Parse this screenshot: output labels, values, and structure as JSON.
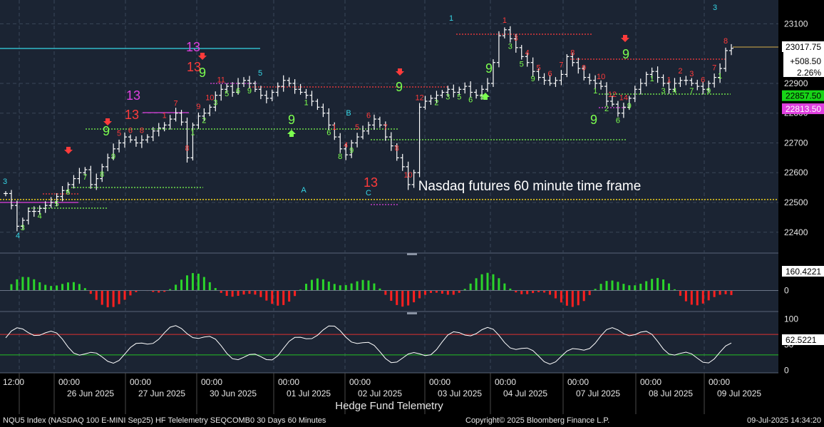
{
  "colors": {
    "bg": "#1b2433",
    "grid": "#3a4658",
    "bar": "#ffffff",
    "buy": "#7cff4f",
    "sell": "#ff3b3b",
    "cyan": "#35d6e6",
    "magenta": "#e040e0",
    "yellow": "#f2d21b"
  },
  "chart_data": [
    {
      "type": "ohlc",
      "title": "Nasdaq futures 60 minute time frame",
      "y_axis": {
        "ticks": [
          22400,
          22500,
          22600,
          22700,
          22800,
          22900,
          23100
        ],
        "ylim": [
          22330,
          23180
        ]
      },
      "x_axis": {
        "ticks": [
          {
            "time": "12:00",
            "date": ""
          },
          {
            "time": "00:00",
            "date": "26 Jun 2025"
          },
          {
            "time": "00:00",
            "date": "27 Jun 2025"
          },
          {
            "time": "00:00",
            "date": "30 Jun 2025"
          },
          {
            "time": "00:00",
            "date": "01 Jul 2025"
          },
          {
            "time": "00:00",
            "date": "02 Jul 2025"
          },
          {
            "time": "00:00",
            "date": "03 Jul 2025"
          },
          {
            "time": "00:00",
            "date": "04 Jul 2025"
          },
          {
            "time": "00:00",
            "date": "07 Jul 2025"
          },
          {
            "time": "00:00",
            "date": "08 Jul 2025"
          },
          {
            "time": "00:00",
            "date": "09 Jul 2025"
          }
        ]
      },
      "series": [
        {
          "values": [
            22530,
            22490,
            22420,
            22440,
            22470,
            22470,
            22480,
            22490,
            22500,
            22520,
            22540,
            22560,
            22580,
            22600,
            22610,
            22560,
            22580,
            22620,
            22650,
            22680,
            22700,
            22720,
            22710,
            22700,
            22710,
            22720,
            22740,
            22750,
            22760,
            22780,
            22800,
            22770,
            22650,
            22760,
            22790,
            22800,
            22820,
            22860,
            22880,
            22890,
            22870,
            22900,
            22910,
            22900,
            22880,
            22860,
            22850,
            22870,
            22890,
            22910,
            22900,
            22880,
            22870,
            22860,
            22840,
            22820,
            22800,
            22760,
            22720,
            22680,
            22660,
            22700,
            22720,
            22740,
            22760,
            22780,
            22760,
            22720,
            22690,
            22650,
            22620,
            22560,
            22600,
            22820,
            22840,
            22850,
            22860,
            22870,
            22880,
            22870,
            22880,
            22890,
            22870,
            22860,
            22880,
            22900,
            22970,
            23060,
            23080,
            23050,
            23020,
            22990,
            22970,
            22940,
            22920,
            22910,
            22900,
            22910,
            22930,
            22990,
            22970,
            22950,
            22920,
            22910,
            22900,
            22890,
            22840,
            22830,
            22800,
            22820,
            22850,
            22880,
            22900,
            22930,
            22940,
            22920,
            22900,
            22880,
            22900,
            22910,
            22910,
            22900,
            22890,
            22880,
            22900,
            22920,
            22950,
            23010,
            23017.75
          ]
        }
      ],
      "price_labels": [
        {
          "value": 23017.75,
          "text": "23017.75",
          "bg": "#ffffff",
          "fg": "#000000"
        },
        {
          "value": 22857.5,
          "text": "22857.50",
          "bg": "#17d417",
          "fg": "#000000"
        },
        {
          "value": 22813.5,
          "text": "22813.50",
          "bg": "#e040e0",
          "fg": "#ffffff"
        }
      ],
      "change_box": [
        "+508.50",
        "2.26%"
      ],
      "annotations": {
        "buy_counts": [
          {
            "i": 3,
            "t": "3"
          },
          {
            "i": 6,
            "t": "4"
          },
          {
            "i": 9,
            "t": "5"
          },
          {
            "i": 11,
            "t": "6"
          },
          {
            "i": 14,
            "t": "7"
          },
          {
            "i": 17,
            "t": "8"
          },
          {
            "i": 19,
            "t": "9"
          },
          {
            "i": 33,
            "t": "1"
          },
          {
            "i": 35,
            "t": "2"
          },
          {
            "i": 37,
            "t": "3"
          },
          {
            "i": 39,
            "t": "5"
          },
          {
            "i": 41,
            "t": "6"
          },
          {
            "i": 43,
            "t": "9"
          },
          {
            "i": 53,
            "t": "1"
          },
          {
            "i": 57,
            "t": "6"
          },
          {
            "i": 59,
            "t": "8"
          },
          {
            "i": 61,
            "t": "9"
          },
          {
            "i": 76,
            "t": "2"
          },
          {
            "i": 78,
            "t": "3"
          },
          {
            "i": 80,
            "t": "5"
          },
          {
            "i": 82,
            "t": "6"
          },
          {
            "i": 84,
            "t": "9"
          },
          {
            "i": 89,
            "t": "3"
          },
          {
            "i": 91,
            "t": "5"
          },
          {
            "i": 93,
            "t": "9"
          },
          {
            "i": 104,
            "t": "1"
          },
          {
            "i": 106,
            "t": "2"
          },
          {
            "i": 108,
            "t": "6"
          },
          {
            "i": 110,
            "t": "9"
          },
          {
            "i": 114,
            "t": "1"
          },
          {
            "i": 116,
            "t": "3"
          },
          {
            "i": 118,
            "t": "4"
          },
          {
            "i": 121,
            "t": "7"
          },
          {
            "i": 124,
            "t": "9"
          },
          {
            "i": 126,
            "t": "1"
          }
        ],
        "sell_counts": [
          {
            "i": 20,
            "t": "5"
          },
          {
            "i": 22,
            "t": "6"
          },
          {
            "i": 24,
            "t": "8"
          },
          {
            "i": 28,
            "t": "1"
          },
          {
            "i": 30,
            "t": "7"
          },
          {
            "i": 32,
            "t": "8"
          },
          {
            "i": 34,
            "t": "9"
          },
          {
            "i": 36,
            "t": "10"
          },
          {
            "i": 38,
            "t": "11"
          },
          {
            "i": 58,
            "t": "1"
          },
          {
            "i": 60,
            "t": "4"
          },
          {
            "i": 62,
            "t": "5"
          },
          {
            "i": 64,
            "t": "6"
          },
          {
            "i": 67,
            "t": "7"
          },
          {
            "i": 69,
            "t": "8"
          },
          {
            "i": 71,
            "t": "10"
          },
          {
            "i": 73,
            "t": "12"
          },
          {
            "i": 88,
            "t": "1"
          },
          {
            "i": 90,
            "t": "3"
          },
          {
            "i": 92,
            "t": "4"
          },
          {
            "i": 94,
            "t": "5"
          },
          {
            "i": 96,
            "t": "6"
          },
          {
            "i": 98,
            "t": "7"
          },
          {
            "i": 100,
            "t": "8"
          },
          {
            "i": 102,
            "t": "9"
          },
          {
            "i": 105,
            "t": "10"
          },
          {
            "i": 107,
            "t": "12"
          },
          {
            "i": 109,
            "t": "14"
          },
          {
            "i": 117,
            "t": "1"
          },
          {
            "i": 119,
            "t": "2"
          },
          {
            "i": 121,
            "t": "3"
          },
          {
            "i": 123,
            "t": "6"
          },
          {
            "i": 125,
            "t": "7"
          },
          {
            "i": 127,
            "t": "8"
          }
        ],
        "big_labels": [
          {
            "x": 271,
            "y": 72,
            "t": "13",
            "c": "magenta"
          },
          {
            "x": 187,
            "y": 140,
            "t": "13",
            "c": "magenta"
          },
          {
            "x": 272,
            "y": 100,
            "t": "13",
            "c": "sell"
          },
          {
            "x": 185,
            "y": 167,
            "t": "13",
            "c": "sell"
          },
          {
            "x": 520,
            "y": 262,
            "t": "13",
            "c": "sell"
          },
          {
            "x": 284,
            "y": 108,
            "t": "9",
            "c": "buy"
          },
          {
            "x": 149,
            "y": 190,
            "t": "9",
            "c": "buy"
          },
          {
            "x": 409,
            "y": 174,
            "t": "9",
            "c": "buy"
          },
          {
            "x": 560,
            "y": 128,
            "t": "9",
            "c": "buy"
          },
          {
            "x": 686,
            "y": 102,
            "t": "9",
            "c": "buy"
          },
          {
            "x": 833,
            "y": 174,
            "t": "9",
            "c": "buy"
          },
          {
            "x": 878,
            "y": 82,
            "t": "9",
            "c": "buy"
          }
        ],
        "cyan_letters": [
          {
            "x": 426,
            "y": 270,
            "t": "A"
          },
          {
            "x": 489,
            "y": 162,
            "t": "B"
          },
          {
            "x": 517,
            "y": 274,
            "t": "C"
          }
        ],
        "cyan_numbers": [
          {
            "x": 7,
            "y": 258,
            "t": "3"
          },
          {
            "x": 25,
            "y": 334,
            "t": "4"
          },
          {
            "x": 633,
            "y": 29,
            "t": "1"
          },
          {
            "x": 365,
            "y": 106,
            "t": "5"
          },
          {
            "x": 1003,
            "y": 14,
            "t": "3"
          }
        ]
      }
    },
    {
      "type": "bar",
      "name": "momentum",
      "label": "160.4221",
      "ylim": [
        -40,
        40
      ]
    },
    {
      "type": "line",
      "name": "oscillator",
      "label": "62.5221",
      "ticks": [
        100,
        50,
        0
      ],
      "ylim": [
        -5,
        105
      ],
      "bands": [
        70,
        30
      ]
    }
  ],
  "footer": {
    "left": "NQU5 Index (NASDAQ 100 E-MINI Sep25) HF Telelemetry SEQCOMB0 30 Days 60 Minutes",
    "center": "Copyright© 2025 Bloomberg Finance L.P.",
    "right": "09-Jul-2025 14:34:20"
  },
  "bottom_title": "Hedge Fund Telemetry"
}
